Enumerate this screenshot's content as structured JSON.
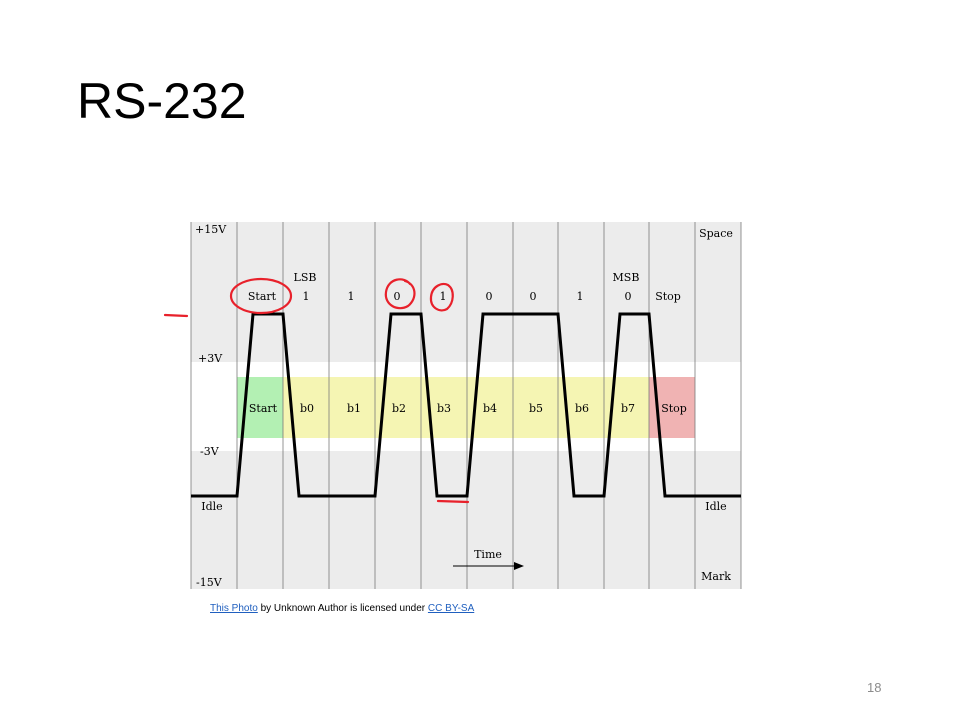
{
  "slide": {
    "title": "RS-232",
    "page_number": "18"
  },
  "attribution": {
    "photo_link": "This Photo",
    "middle_text": " by Unknown Author is licensed under ",
    "license_link": "CC BY-SA"
  },
  "diagram": {
    "voltage_labels": [
      "+15V",
      "+3V",
      "-3V",
      "-15V"
    ],
    "state_labels": {
      "space": "Space",
      "mark": "Mark",
      "idle_left": "Idle",
      "idle_right": "Idle"
    },
    "bit_order_labels": {
      "lsb": "LSB",
      "msb": "MSB"
    },
    "bit_values": [
      "Start",
      "1",
      "1",
      "0",
      "1",
      "0",
      "0",
      "1",
      "0",
      "Stop"
    ],
    "band_labels": [
      "Start",
      "b0",
      "b1",
      "b2",
      "b3",
      "b4",
      "b5",
      "b6",
      "b7",
      "Stop"
    ],
    "time_label": "Time",
    "colors": {
      "start_band": "#b3f0b3",
      "data_band": "#f5f5b3",
      "stop_band": "#f0b3b3",
      "background_band": "#ececec",
      "annotation": "#e8212b"
    }
  }
}
